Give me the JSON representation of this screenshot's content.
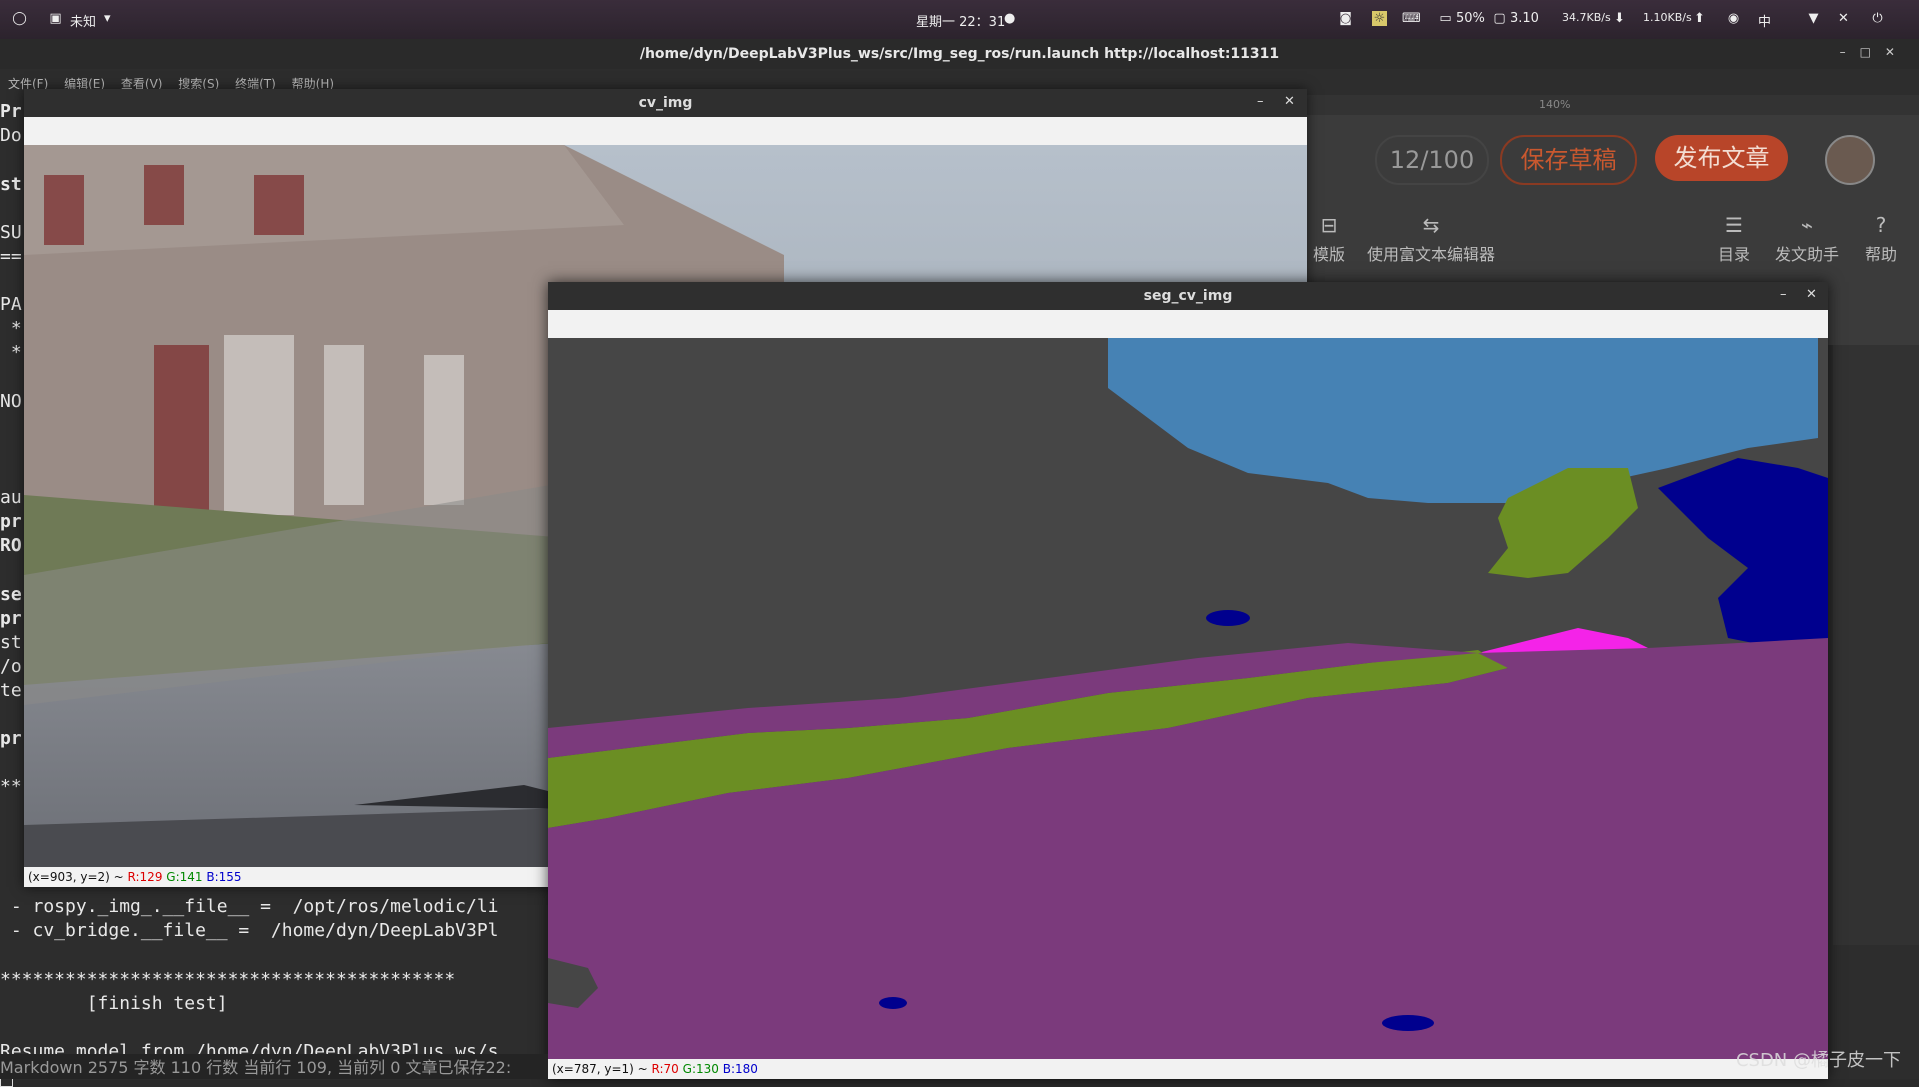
{
  "topbar": {
    "app_menu": "未知",
    "clock": "星期一 22：31",
    "battery": "50%",
    "cpu": "3.10",
    "net_down": "34.7KB/s",
    "net_up": "1.10KB/s",
    "input_method": "中",
    "icons": [
      "circle-icon",
      "window-icon",
      "camera-icon",
      "brightness-icon",
      "keyboard-icon",
      "battery-icon",
      "monitor-icon",
      "down-arrow-icon",
      "up-arrow-icon",
      "language-icon",
      "wifi-icon",
      "mute-icon",
      "power-icon"
    ]
  },
  "terminal": {
    "title": "/home/dyn/DeepLabV3Plus_ws/src/Img_seg_ros/run.launch http://localhost:11311",
    "menu": [
      "文件(F)",
      "编辑(E)",
      "查看(V)",
      "搜索(S)",
      "终端(T)",
      "帮助(H)"
    ],
    "lines_left": [
      "Pr",
      "Do",
      "st",
      "SU",
      "==",
      "PA",
      " *",
      " *",
      "NO",
      "au",
      "pr",
      "RO",
      "se",
      "pr",
      "st",
      "/o",
      "te",
      "pr",
      "**"
    ],
    "line_cvbridge": " - cv_bridge.__file__ =  /home/dyn/DeepLabV3Pl",
    "line_stars": "******************************************",
    "line_finish": "        [finish test]",
    "line_resume": "Resume model from /home/dyn/DeepLabV3Plus_ws/s",
    "line_prev": " - rospy._img_.__file__ =  /opt/ros/melodic/li"
  },
  "editor": {
    "zoom": "140%",
    "word_count": "12/100",
    "save_draft": "保存草稿",
    "publish": "发布文章",
    "tools": [
      "模版",
      "使用富文本编辑器",
      "目录",
      "发文助手",
      "帮助"
    ]
  },
  "cv_window": {
    "title": "cv_img",
    "status_pos": "(x=903, y=2) ~ ",
    "status_r": "R:129",
    "status_g": "G:141",
    "status_b": "B:155"
  },
  "seg_window": {
    "title": "seg_cv_img",
    "status_pos": "(x=787, y=1) ~ ",
    "status_r": "R:70",
    "status_g": "G:130",
    "status_b": "B:180"
  },
  "editor_status": {
    "text": "Markdown  2575 字数  110 行数  当前行 109, 当前列 0  文章已保存22:"
  },
  "watermark": "CSDN @橘子皮一下",
  "colors": {
    "road": "#7b3a7c",
    "sky": "#4682b4",
    "building": "#464646",
    "vegetation": "#6b8e23",
    "car": "#00008e",
    "sidewalk": "#f423e8"
  }
}
